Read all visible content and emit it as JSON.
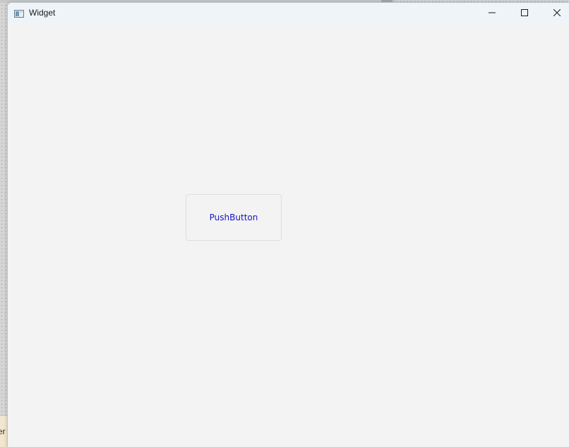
{
  "background": {
    "partial_label": "er"
  },
  "window": {
    "title": "Widget",
    "icon": "app-window-icon",
    "controls": {
      "minimize_icon": "minimize-icon",
      "maximize_icon": "maximize-icon",
      "close_icon": "close-icon"
    }
  },
  "client": {
    "push_button_label": "PushButton"
  },
  "colors": {
    "titlebar_bg": "#eff4f9",
    "client_bg": "#f3f3f3",
    "button_text": "#1515c8"
  }
}
